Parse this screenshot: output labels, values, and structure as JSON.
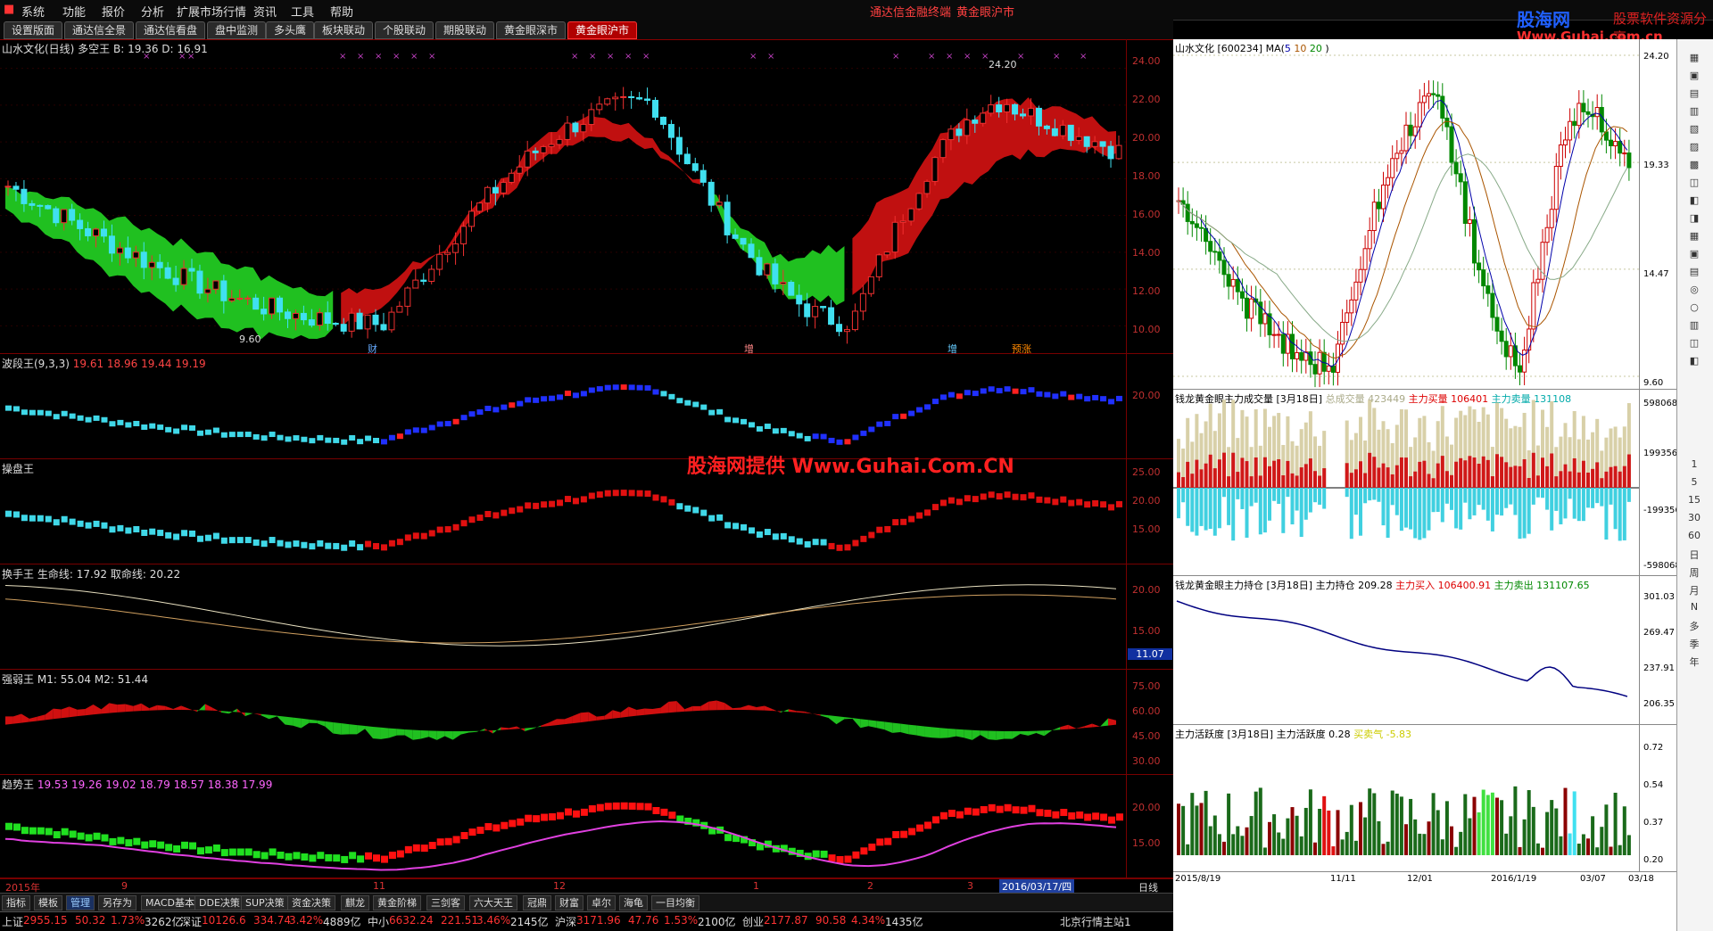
{
  "menu": [
    "系统",
    "功能",
    "报价",
    "分析",
    "扩展市场行情",
    "资讯",
    "工具",
    "帮助"
  ],
  "center_titles": [
    "通达信金融终端",
    "黄金眼沪市"
  ],
  "logo": {
    "brand": "股海网",
    "slogan": "股票软件资源分享",
    "url": "Www.Guhai.com.cn"
  },
  "tabs": [
    "设置版面",
    "通达信全景",
    "通达信看盘",
    "盘中监测",
    "多头鹰",
    "板块联动",
    "个股联动",
    "期股联动",
    "黄金眼深市",
    "黄金眼沪市"
  ],
  "active_tab": 9,
  "watermark": "股海网提供 Www.Guhai.Com.CN",
  "panels": {
    "main": {
      "title": "山水文化(日线) 多空王",
      "b": "B: 19.36",
      "d": "D: 16.91",
      "ticks": [
        "24.00",
        "22.00",
        "20.00",
        "18.00",
        "16.00",
        "14.00",
        "12.00",
        "10.00"
      ],
      "hi_label": "24.20",
      "lo_label": "9.60",
      "events": [
        "财",
        "增",
        "增",
        "预涨"
      ]
    },
    "bolang": {
      "title": "波段王(9,3,3)",
      "vals": [
        "19.61",
        "18.96",
        "19.44",
        "19.19"
      ],
      "ticks": [
        "20.00"
      ]
    },
    "caopan": {
      "title": "操盘王",
      "ticks": [
        "25.00",
        "20.00",
        "15.00"
      ]
    },
    "huanshou": {
      "title": "换手王",
      "life": "生命线: 17.92",
      "profit": "取命线: 20.22",
      "ticks": [
        "20.00",
        "15.00"
      ],
      "badge": "11.07"
    },
    "qiangruo": {
      "title": "强弱王",
      "m1": "M1: 55.04",
      "m2": "M2: 51.44",
      "ticks": [
        "75.00",
        "60.00",
        "45.00",
        "30.00"
      ]
    },
    "qushi": {
      "title": "趋势王",
      "vals": [
        "19.53",
        "19.26",
        "19.02",
        "18.79",
        "18.57",
        "18.38",
        "17.99"
      ],
      "ticks": [
        "20.00",
        "15.00"
      ]
    }
  },
  "date_axis": {
    "labels": [
      "2015年",
      "9",
      "11",
      "12",
      "1",
      "2",
      "3"
    ],
    "current": "2016/03/17/四",
    "period": "日线"
  },
  "bottom_tabs": [
    "指标",
    "模板",
    "管理",
    "另存为",
    "MACD基本",
    "DDE决策",
    "SUP决策",
    "资金决策",
    "麒龙",
    "黄金阶梯",
    "三剑客",
    "六大天王",
    "冠鼎",
    "财富",
    "卓尔",
    "海龟",
    "一目均衡"
  ],
  "bottom_active": 2,
  "status": [
    {
      "name": "上证",
      "val": "2955.15",
      "chg": "50.32",
      "pct": "1.73%",
      "amt": "3262亿"
    },
    {
      "name": "深证",
      "val": "10126.6",
      "chg": "334.74",
      "pct": "3.42%",
      "amt": "4889亿"
    },
    {
      "name": "中小",
      "val": "6632.24",
      "chg": "221.51",
      "pct": "3.46%",
      "amt": "2145亿"
    },
    {
      "name": "沪深",
      "val": "3171.96",
      "chg": "47.76",
      "pct": "1.53%",
      "amt": "2100亿"
    },
    {
      "name": "创业",
      "val": "2177.87",
      "chg": "90.58",
      "pct": "4.34%",
      "amt": "1435亿"
    }
  ],
  "status_right": "北京行情主站1",
  "right": {
    "kline": {
      "title": "山水文化",
      "code": "[600234]",
      "ma": "MA(",
      "ma1": "5",
      "ma2": "10",
      "ma3": "20",
      ")": ")",
      "ticks": [
        "24.20",
        "19.33",
        "14.47",
        "9.60"
      ]
    },
    "volume": {
      "title": "钱龙黄金眼主力成交量",
      "date": "[3月18日]",
      "total_l": "总成交量",
      "total": "423449",
      "buy_l": "主力买量",
      "buy": "106401",
      "sell_l": "主力卖量",
      "sell": "131108",
      "ticks": [
        "598068",
        "199356",
        "-199356",
        "-598068"
      ]
    },
    "hold": {
      "title": "钱龙黄金眼主力持仓",
      "date": "[3月18日]",
      "v_l": "主力持仓",
      "v": "209.28",
      "buy_l": "主力买入",
      "buy": "106400.91",
      "sell_l": "主力卖出",
      "sell": "131107.65",
      "ticks": [
        "301.03",
        "269.47",
        "237.91",
        "206.35"
      ]
    },
    "active": {
      "title": "主力活跃度",
      "date": "[3月18日]",
      "v_l": "主力活跃度",
      "v": "0.28",
      "bs_l": "买卖气",
      "bs": "-5.83",
      "ticks": [
        "0.72",
        "0.54",
        "0.37",
        "0.20"
      ]
    },
    "dates": [
      "2015/8/19",
      "11/11",
      "12/01",
      "2016/1/19",
      "03/07",
      "03/18"
    ]
  },
  "tools": [
    "日",
    "周",
    "月",
    "N",
    "多",
    "季",
    "年"
  ],
  "tool_nums": [
    "1",
    "5",
    "15",
    "30",
    "60"
  ],
  "colors": {
    "up": "#e01010",
    "down": "#30d8e8",
    "green": "#20d020",
    "bg": "#000000"
  }
}
